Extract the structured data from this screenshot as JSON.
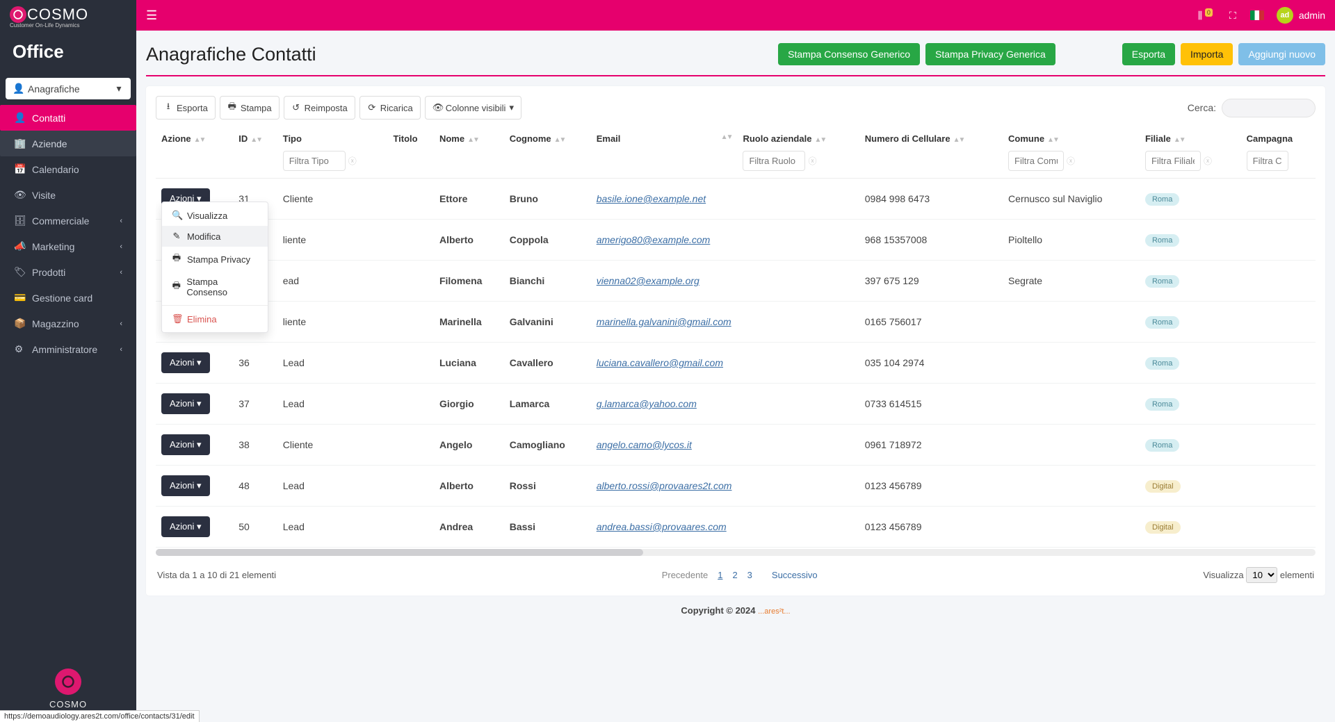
{
  "brand": {
    "name": "COSMO",
    "subtitle": "Customer On-Life Dynamics",
    "module": "Office",
    "footer": "COSMO"
  },
  "topbar": {
    "username": "admin",
    "avatar_initials": "ad",
    "notif_badge": "0"
  },
  "sidebar": {
    "selector": {
      "label": "Anagrafiche"
    },
    "items": [
      {
        "label": "Contatti",
        "active": true
      },
      {
        "label": "Aziende",
        "sub": true
      },
      {
        "label": "Calendario"
      },
      {
        "label": "Visite"
      },
      {
        "label": "Commerciale",
        "expandable": true
      },
      {
        "label": "Marketing",
        "expandable": true
      },
      {
        "label": "Prodotti",
        "expandable": true
      },
      {
        "label": "Gestione card"
      },
      {
        "label": "Magazzino",
        "expandable": true
      },
      {
        "label": "Amministratore",
        "expandable": true
      }
    ]
  },
  "page": {
    "title": "Anagrafiche Contatti",
    "head_buttons": {
      "consenso": "Stampa Consenso Generico",
      "privacy": "Stampa Privacy Generica",
      "esporta": "Esporta",
      "importa": "Importa",
      "aggiungi": "Aggiungi nuovo"
    }
  },
  "toolbar": {
    "esporta": "Esporta",
    "stampa": "Stampa",
    "reimposta": "Reimposta",
    "ricarica": "Ricarica",
    "colonne": "Colonne visibili",
    "search_label": "Cerca:"
  },
  "columns": {
    "azione": "Azione",
    "id": "ID",
    "tipo": "Tipo",
    "titolo": "Titolo",
    "nome": "Nome",
    "cognome": "Cognome",
    "email": "Email",
    "ruolo": "Ruolo aziendale",
    "cellulare": "Numero di Cellulare",
    "comune": "Comune",
    "filiale": "Filiale",
    "campagna": "Campagna"
  },
  "filters": {
    "tipo": "Filtra Tipo",
    "ruolo": "Filtra Ruolo",
    "comune": "Filtra Comun",
    "filiale": "Filtra Filiale",
    "campagna": "Filtra Ca"
  },
  "action_button_label": "Azioni",
  "action_menu": {
    "visualizza": "Visualizza",
    "modifica": "Modifica",
    "stampa_privacy": "Stampa Privacy",
    "stampa_consenso": "Stampa Consenso",
    "elimina": "Elimina"
  },
  "rows": [
    {
      "id": "31",
      "tipo": "Cliente",
      "nome": "Ettore",
      "cognome": "Bruno",
      "email": "basile.ione@example.net",
      "cell": "0984 998 6473",
      "comune": "Cernusco sul Naviglio",
      "filiale": "Roma",
      "filiale_style": "roma"
    },
    {
      "id": "",
      "tipo": "liente",
      "nome": "Alberto",
      "cognome": "Coppola",
      "email": "amerigo80@example.com",
      "cell": "968 15357008",
      "comune": "Pioltello",
      "filiale": "Roma",
      "filiale_style": "roma"
    },
    {
      "id": "",
      "tipo": "ead",
      "nome": "Filomena",
      "cognome": "Bianchi",
      "email": "vienna02@example.org",
      "cell": "397 675 129",
      "comune": "Segrate",
      "filiale": "Roma",
      "filiale_style": "roma"
    },
    {
      "id": "",
      "tipo": "liente",
      "nome": "Marinella",
      "cognome": "Galvanini",
      "email": "marinella.galvanini@gmail.com",
      "cell": "0165 756017",
      "comune": "",
      "filiale": "Roma",
      "filiale_style": "roma"
    },
    {
      "id": "36",
      "tipo": "Lead",
      "nome": "Luciana",
      "cognome": "Cavallero",
      "email": "luciana.cavallero@gmail.com",
      "cell": "035 104 2974",
      "comune": "",
      "filiale": "Roma",
      "filiale_style": "roma"
    },
    {
      "id": "37",
      "tipo": "Lead",
      "nome": "Giorgio",
      "cognome": "Lamarca",
      "email": "g.lamarca@yahoo.com",
      "cell": "0733 614515",
      "comune": "",
      "filiale": "Roma",
      "filiale_style": "roma"
    },
    {
      "id": "38",
      "tipo": "Cliente",
      "nome": "Angelo",
      "cognome": "Camogliano",
      "email": "angelo.camo@lycos.it",
      "cell": "0961 718972",
      "comune": "",
      "filiale": "Roma",
      "filiale_style": "roma"
    },
    {
      "id": "48",
      "tipo": "Lead",
      "nome": "Alberto",
      "cognome": "Rossi",
      "email": "alberto.rossi@provaares2t.com",
      "cell": "0123 456789",
      "comune": "",
      "filiale": "Digital",
      "filiale_style": "digital"
    },
    {
      "id": "50",
      "tipo": "Lead",
      "nome": "Andrea",
      "cognome": "Bassi",
      "email": "andrea.bassi@provaares.com",
      "cell": "0123 456789",
      "comune": "",
      "filiale": "Digital",
      "filiale_style": "digital"
    }
  ],
  "footer": {
    "info": "Vista da 1 a 10 di 21 elementi",
    "prev": "Precedente",
    "pages": [
      "1",
      "2",
      "3"
    ],
    "next": "Successivo",
    "visualizza": "Visualizza",
    "elementi": "elementi",
    "per_page": "10"
  },
  "copyright": {
    "text": "Copyright © 2024",
    "brand": "...ares²t..."
  },
  "status_url": "https://demoaudiology.ares2t.com/office/contacts/31/edit"
}
